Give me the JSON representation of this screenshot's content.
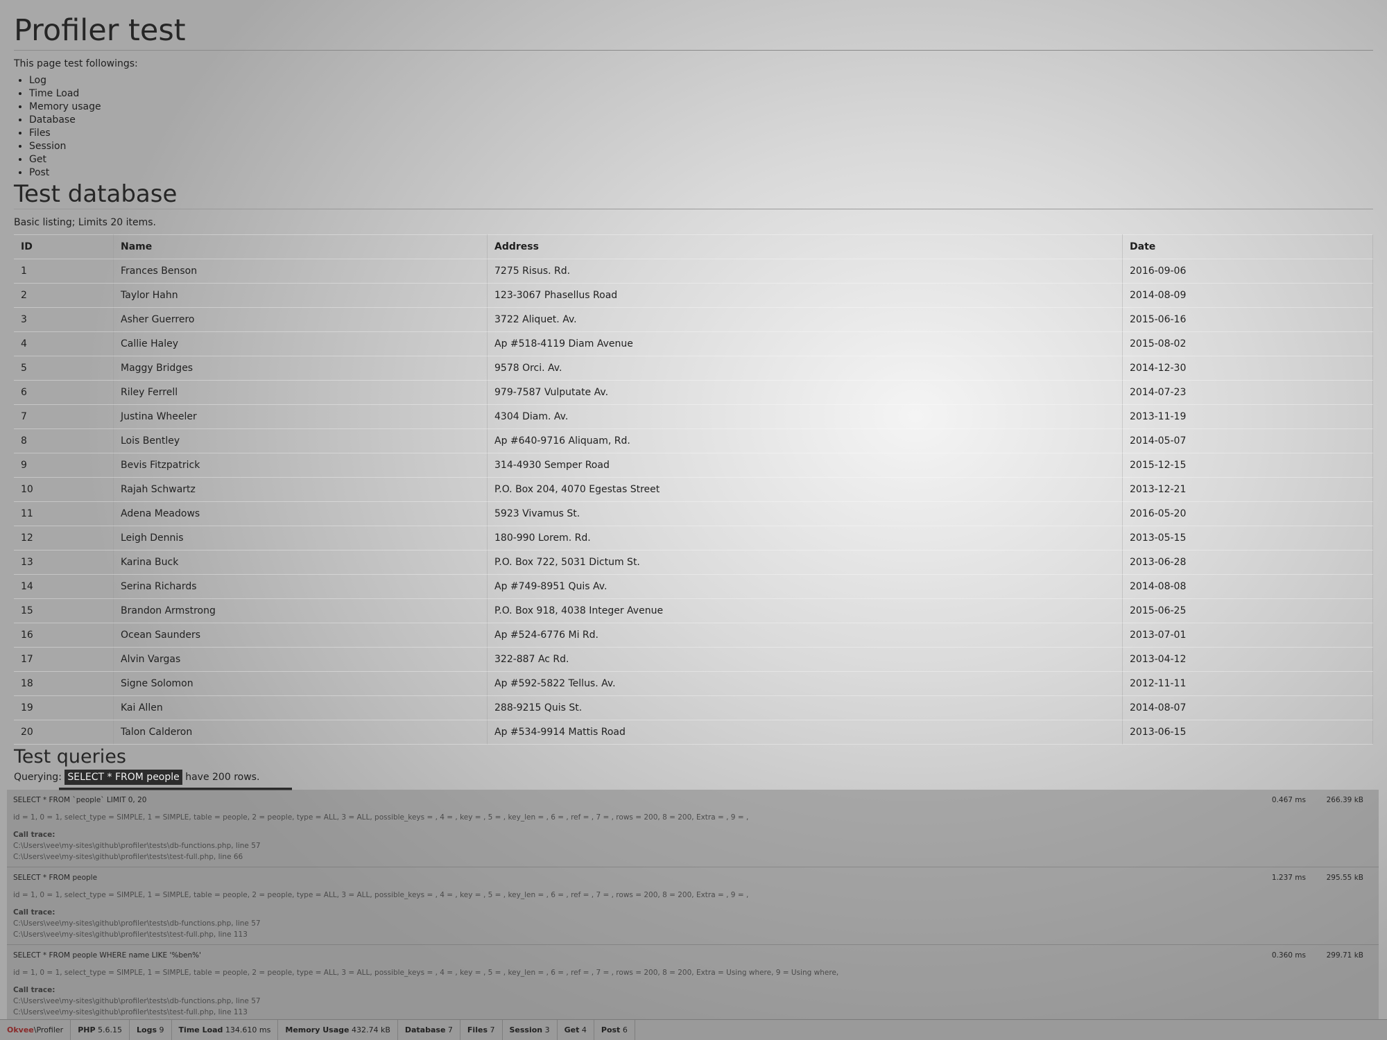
{
  "page": {
    "title": "Profiler test",
    "intro": "This page test followings:",
    "features": [
      "Log",
      "Time Load",
      "Memory usage",
      "Database",
      "Files",
      "Session",
      "Get",
      "Post"
    ]
  },
  "database": {
    "heading": "Test database",
    "subtitle": "Basic listing; Limits 20 items.",
    "columns": [
      "ID",
      "Name",
      "Address",
      "Date"
    ],
    "rows": [
      [
        "1",
        "Frances Benson",
        "7275 Risus. Rd.",
        "2016-09-06"
      ],
      [
        "2",
        "Taylor Hahn",
        "123-3067 Phasellus Road",
        "2014-08-09"
      ],
      [
        "3",
        "Asher Guerrero",
        "3722 Aliquet. Av.",
        "2015-06-16"
      ],
      [
        "4",
        "Callie Haley",
        "Ap #518-4119 Diam Avenue",
        "2015-08-02"
      ],
      [
        "5",
        "Maggy Bridges",
        "9578 Orci. Av.",
        "2014-12-30"
      ],
      [
        "6",
        "Riley Ferrell",
        "979-7587 Vulputate Av.",
        "2014-07-23"
      ],
      [
        "7",
        "Justina Wheeler",
        "4304 Diam. Av.",
        "2013-11-19"
      ],
      [
        "8",
        "Lois Bentley",
        "Ap #640-9716 Aliquam, Rd.",
        "2014-05-07"
      ],
      [
        "9",
        "Bevis Fitzpatrick",
        "314-4930 Semper Road",
        "2015-12-15"
      ],
      [
        "10",
        "Rajah Schwartz",
        "P.O. Box 204, 4070 Egestas Street",
        "2013-12-21"
      ],
      [
        "11",
        "Adena Meadows",
        "5923 Vivamus St.",
        "2016-05-20"
      ],
      [
        "12",
        "Leigh Dennis",
        "180-990 Lorem. Rd.",
        "2013-05-15"
      ],
      [
        "13",
        "Karina Buck",
        "P.O. Box 722, 5031 Dictum St.",
        "2013-06-28"
      ],
      [
        "14",
        "Serina Richards",
        "Ap #749-8951 Quis Av.",
        "2014-08-08"
      ],
      [
        "15",
        "Brandon Armstrong",
        "P.O. Box 918, 4038 Integer Avenue",
        "2015-06-25"
      ],
      [
        "16",
        "Ocean Saunders",
        "Ap #524-6776 Mi Rd.",
        "2013-07-01"
      ],
      [
        "17",
        "Alvin Vargas",
        "322-887 Ac Rd.",
        "2013-04-12"
      ],
      [
        "18",
        "Signe Solomon",
        "Ap #592-5822 Tellus. Av.",
        "2012-11-11"
      ],
      [
        "19",
        "Kai Allen",
        "288-9215 Quis St.",
        "2014-08-07"
      ],
      [
        "20",
        "Talon Calderon",
        "Ap #534-9914 Mattis Road",
        "2013-06-15"
      ]
    ]
  },
  "queries": {
    "heading": "Test queries",
    "prefix": "Querying:",
    "sql": "SELECT * FROM people",
    "suffix": "have 200 rows."
  },
  "profiler_queries": [
    {
      "sql": "SELECT * FROM `people` LIMIT 0, 20",
      "time": "0.467 ms",
      "memory": "266.39 kB",
      "explain": "id = 1, 0 = 1, select_type = SIMPLE, 1 = SIMPLE, table = people, 2 = people, type = ALL, 3 = ALL, possible_keys = , 4 = , key = , 5 = , key_len = , 6 = , ref = , 7 = , rows = 200, 8 = 200, Extra = , 9 = ,",
      "trace_label": "Call trace:",
      "trace": [
        "C:\\Users\\vee\\my-sites\\github\\profiler\\tests\\db-functions.php, line 57",
        "C:\\Users\\vee\\my-sites\\github\\profiler\\tests\\test-full.php, line 66"
      ]
    },
    {
      "sql": "SELECT * FROM people",
      "time": "1.237 ms",
      "memory": "295.55 kB",
      "explain": "id = 1, 0 = 1, select_type = SIMPLE, 1 = SIMPLE, table = people, 2 = people, type = ALL, 3 = ALL, possible_keys = , 4 = , key = , 5 = , key_len = , 6 = , ref = , 7 = , rows = 200, 8 = 200, Extra = , 9 = ,",
      "trace_label": "Call trace:",
      "trace": [
        "C:\\Users\\vee\\my-sites\\github\\profiler\\tests\\db-functions.php, line 57",
        "C:\\Users\\vee\\my-sites\\github\\profiler\\tests\\test-full.php, line 113"
      ]
    },
    {
      "sql": "SELECT * FROM people WHERE name LIKE '%ben%'",
      "time": "0.360 ms",
      "memory": "299.71 kB",
      "explain": "id = 1, 0 = 1, select_type = SIMPLE, 1 = SIMPLE, table = people, 2 = people, type = ALL, 3 = ALL, possible_keys = , 4 = , key = , 5 = , key_len = , 6 = , ref = , 7 = , rows = 200, 8 = 200, Extra = Using where, 9 = Using where,",
      "trace_label": "Call trace:",
      "trace": [
        "C:\\Users\\vee\\my-sites\\github\\profiler\\tests\\db-functions.php, line 57",
        "C:\\Users\\vee\\my-sites\\github\\profiler\\tests\\test-full.php, line 113"
      ]
    }
  ],
  "toolbar": {
    "brand_vendor": "Okvee",
    "brand_name": "\\Profiler",
    "items": [
      {
        "label": "PHP",
        "value": "5.6.15"
      },
      {
        "label": "Logs",
        "value": "9"
      },
      {
        "label": "Time Load",
        "value": "134.610 ms"
      },
      {
        "label": "Memory Usage",
        "value": "432.74 kB"
      },
      {
        "label": "Database",
        "value": "7"
      },
      {
        "label": "Files",
        "value": "7"
      },
      {
        "label": "Session",
        "value": "3"
      },
      {
        "label": "Get",
        "value": "4"
      },
      {
        "label": "Post",
        "value": "6"
      }
    ]
  }
}
